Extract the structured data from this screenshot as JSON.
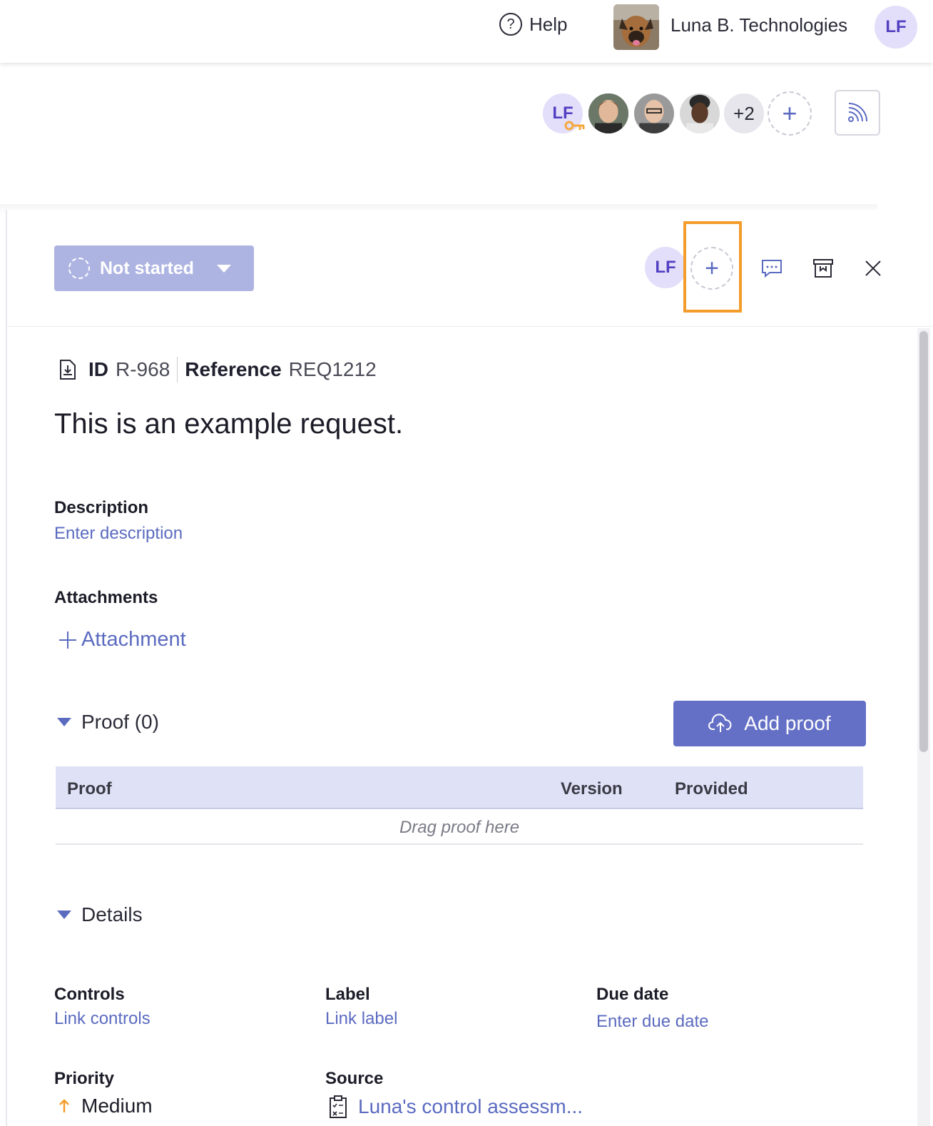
{
  "topbar": {
    "help_label": "Help",
    "help_icon": "question-circle-icon",
    "org_name": "Luna B. Technologies",
    "user_initials": "LF"
  },
  "collaborators": {
    "owner_initials": "LF",
    "more_count": "+2",
    "add_symbol": "+"
  },
  "panel": {
    "status_label": "Not started",
    "assignee_initials": "LF",
    "assign_add_symbol": "+",
    "id_label": "ID",
    "id_value": "R-968",
    "reference_label": "Reference",
    "reference_value": "REQ1212",
    "title": "This is an example request.",
    "description_label": "Description",
    "description_placeholder": "Enter description",
    "attachments_label": "Attachments",
    "attachment_link": "Attachment",
    "proof_section": "Proof (0)",
    "add_proof_label": "Add proof",
    "proof_table": {
      "columns": [
        "Proof",
        "Version",
        "Provided"
      ],
      "empty_text": "Drag proof here"
    },
    "details_section": "Details",
    "details": {
      "controls_label": "Controls",
      "controls_link": "Link controls",
      "label_label": "Label",
      "label_link": "Link label",
      "due_date_label": "Due date",
      "due_date_link": "Enter due date",
      "priority_label": "Priority",
      "priority_value": "Medium",
      "source_label": "Source",
      "source_value": "Luna's control assessm..."
    }
  },
  "colors": {
    "accent": "#5b6bc0",
    "status_button": "#aeb4e2",
    "add_proof_button": "#6470c6",
    "highlight": "#f39c2b",
    "priority_arrow": "#f39c2b"
  }
}
